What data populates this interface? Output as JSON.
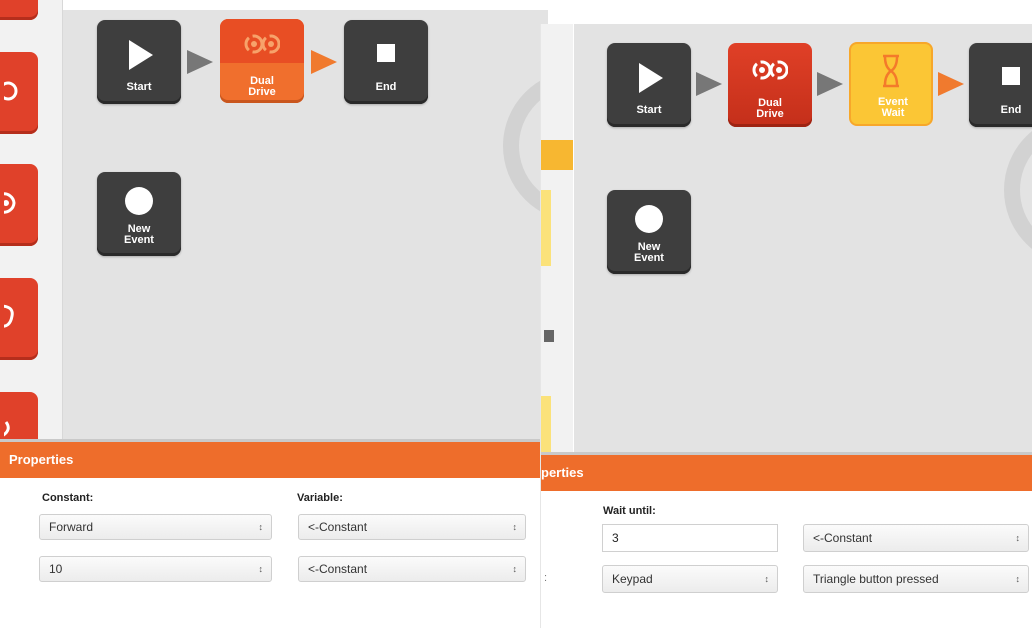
{
  "left": {
    "blocks": {
      "start": "Start",
      "dual_drive": "Dual\nDrive",
      "end": "End",
      "new_event": "New\nEvent"
    },
    "properties": {
      "title": "Properties",
      "constant_label": "Constant:",
      "variable_label": "Variable:",
      "rows": [
        {
          "constant": "Forward",
          "variable": "<-Constant"
        },
        {
          "constant": "10",
          "variable": "<-Constant"
        }
      ]
    }
  },
  "right": {
    "blocks": {
      "start": "Start",
      "dual_drive": "Dual\nDrive",
      "event_wait": "Event\nWait",
      "end": "End",
      "new_event": "New\nEvent"
    },
    "properties": {
      "title": "perties",
      "wait_until_label": "Wait until:",
      "wait_value": "3",
      "wait_variable": "<-Constant",
      "source": "Keypad",
      "condition": "Triangle button pressed"
    }
  },
  "colors": {
    "accent_orange": "#ee6d2b",
    "block_dark": "#3e3e3e",
    "block_red": "#e04027",
    "block_yellow": "#fbc635"
  },
  "icons": [
    "play-icon",
    "stop-icon",
    "motor-drive-icon",
    "hourglass-icon",
    "circle-icon"
  ]
}
